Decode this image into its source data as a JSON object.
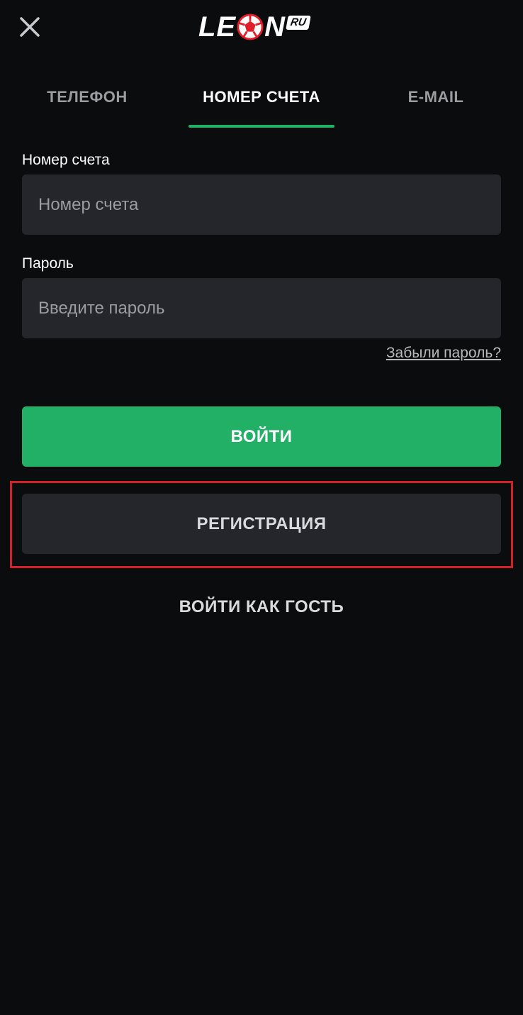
{
  "header": {
    "logo_text_1": "LE",
    "logo_text_2": "N",
    "logo_badge": "RU",
    "close_icon": "close-icon"
  },
  "tabs": [
    {
      "label": "ТЕЛЕФОН",
      "active": false
    },
    {
      "label": "НОМЕР СЧЕТА",
      "active": true
    },
    {
      "label": "E-MAIL",
      "active": false
    }
  ],
  "form": {
    "account_label": "Номер счета",
    "account_placeholder": "Номер счета",
    "account_value": "",
    "password_label": "Пароль",
    "password_placeholder": "Введите пароль",
    "password_value": "",
    "forgot_link": "Забыли пароль?"
  },
  "actions": {
    "login": "ВОЙТИ",
    "register": "РЕГИСТРАЦИЯ",
    "guest": "ВОЙТИ КАК ГОСТЬ"
  },
  "colors": {
    "background": "#0b0c0e",
    "accent_green": "#22b067",
    "input_bg": "#24262b",
    "highlight_red": "#d32027",
    "logo_red": "#e11d2a"
  }
}
